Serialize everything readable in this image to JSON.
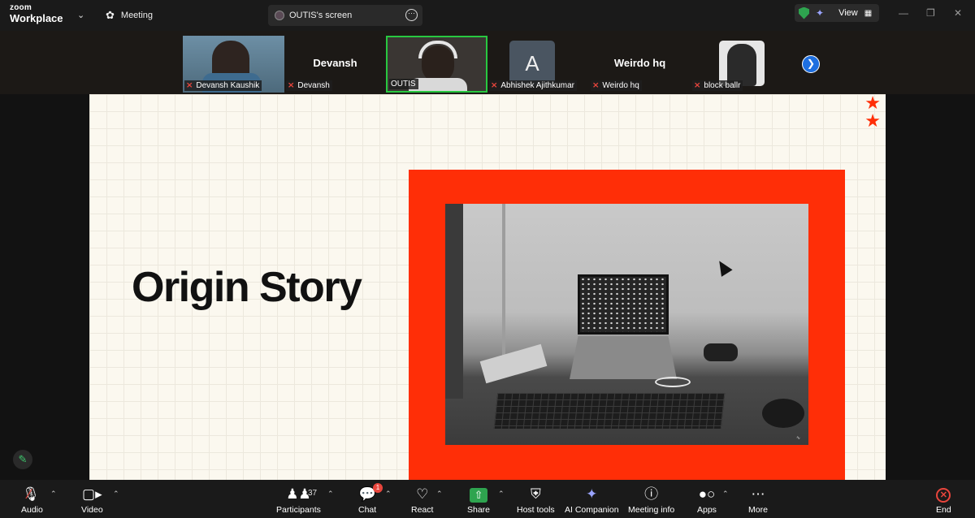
{
  "app": {
    "brand_top": "zoom",
    "brand_bottom": "Workplace",
    "meeting_tab": "Meeting"
  },
  "share_tab": {
    "label": "OUTIS's screen"
  },
  "view": {
    "label": "View"
  },
  "participants": [
    {
      "name": "Devansh Kaushik",
      "muted": true,
      "type": "video"
    },
    {
      "name": "Devansh",
      "muted": true,
      "type": "name",
      "display_name": "Devansh"
    },
    {
      "name": "OUTIS",
      "muted": false,
      "type": "video",
      "active_speaker": true
    },
    {
      "name": "Abhishek Ajithkumar",
      "muted": true,
      "type": "avatar",
      "initial": "A"
    },
    {
      "name": "Weirdo hq",
      "muted": true,
      "type": "name",
      "display_name": "Weirdo hq"
    },
    {
      "name": "block ballr",
      "muted": true,
      "type": "avatar-image"
    }
  ],
  "slide": {
    "title": "Origin Story"
  },
  "toolbar": {
    "audio": "Audio",
    "video": "Video",
    "participants": "Participants",
    "participants_count": "37",
    "chat": "Chat",
    "chat_badge": "1",
    "react": "React",
    "share": "Share",
    "host_tools": "Host tools",
    "ai_companion": "AI Companion",
    "meeting_info": "Meeting info",
    "apps": "Apps",
    "more": "More",
    "end": "End"
  },
  "colors": {
    "active_speaker": "#28c840",
    "slide_accent": "#ff2e07",
    "end": "#e8453c",
    "share": "#2ea44f"
  }
}
